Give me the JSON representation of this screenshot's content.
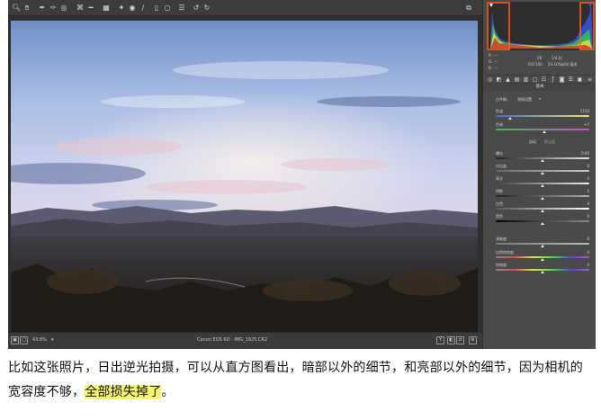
{
  "toolbar": {
    "icons": [
      "zoom-icon",
      "hand-icon",
      "white-balance-icon",
      "color-sampler-icon",
      "target-adjust-icon",
      "crop-icon",
      "straighten-icon",
      "transform-icon",
      "spot-removal-icon",
      "red-eye-icon",
      "brush-icon",
      "graduated-filter-icon",
      "radial-filter-icon",
      "preferences-icon",
      "rotate-ccw-icon",
      "rotate-cw-icon"
    ],
    "right_icon": "fullscreen-icon"
  },
  "status_bar": {
    "zoom": "43.8%",
    "camera_file": "Canon EOS 6D  -  IMG_1925.CR2",
    "view_btn": "Y"
  },
  "histogram": {
    "rgb_labels": {
      "r": "R:",
      "g": "G:",
      "b": "B:"
    },
    "rgb_values": {
      "r": "---",
      "g": "---",
      "b": "---"
    },
    "aperture": "f/8",
    "shutter": "1/4 秒",
    "iso": "ISO 100",
    "lens": "24-105@64 毫米",
    "colors": {
      "clip_box": "#ff5a1f"
    }
  },
  "basic": {
    "section_title": "基本",
    "white_balance_label": "白平衡:",
    "white_balance_value": "原照设置",
    "temp_label": "色温",
    "temp_value": "5150",
    "tint_label": "色调",
    "tint_value": "+7",
    "mode_auto": "自动",
    "mode_default": "默认值",
    "exposure_label": "曝光",
    "exposure_value": "0.00",
    "contrast_label": "对比度",
    "contrast_value": "0",
    "highlights_label": "高光",
    "highlights_value": "0",
    "shadows_label": "阴影",
    "shadows_value": "0",
    "whites_label": "白色",
    "whites_value": "0",
    "blacks_label": "黑色",
    "blacks_value": "0",
    "clarity_label": "清晰度",
    "clarity_value": "0",
    "vibrance_label": "自然饱和度",
    "vibrance_value": "0",
    "saturation_label": "饱和度",
    "saturation_value": "0"
  },
  "caption": {
    "text_before": "比如这张照片，日出逆光拍摄，可以从直方图看出，暗部以外的细节，和亮部以外的细节，因为相机的宽容度不够，",
    "highlight": "全部损失掉了",
    "text_after": "。"
  }
}
